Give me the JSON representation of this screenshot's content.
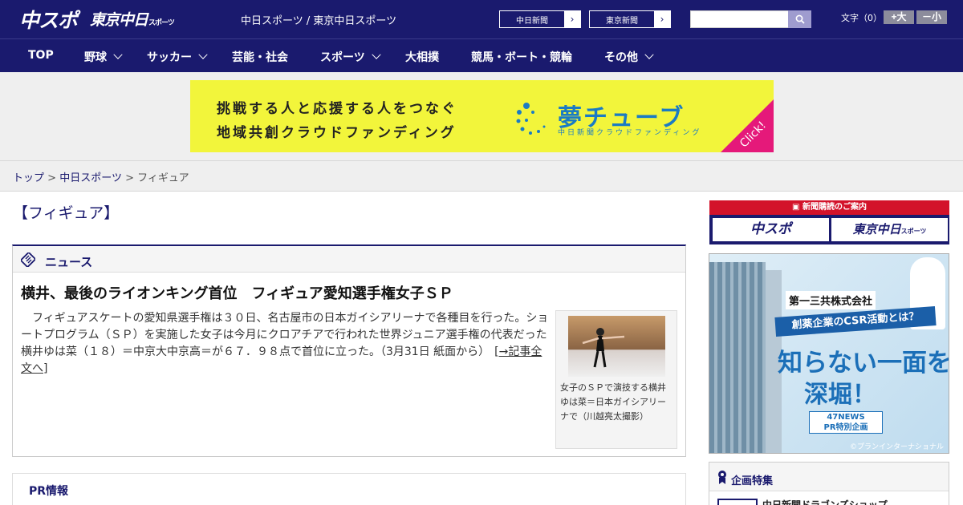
{
  "header": {
    "logo_main": "中スポ",
    "logo_tokyo": "東京中日",
    "logo_tokyo_small": "スポーツ",
    "site_title": "中日スポーツ / 東京中日スポーツ",
    "link_chunichi": "中日新聞",
    "link_tokyo": "東京新聞",
    "link_arrow": "›",
    "search_placeholder": "",
    "font_size_label": "文字（0）",
    "font_plus": "+大",
    "font_minus": "－小"
  },
  "nav": {
    "items": [
      {
        "label": "TOP",
        "has_dropdown": false
      },
      {
        "label": "野球",
        "has_dropdown": true
      },
      {
        "label": "サッカー",
        "has_dropdown": true
      },
      {
        "label": "芸能・社会",
        "has_dropdown": false
      },
      {
        "label": "スポーツ",
        "has_dropdown": true
      },
      {
        "label": "大相撲",
        "has_dropdown": false
      },
      {
        "label": "競馬・ボート・競輪",
        "has_dropdown": false
      },
      {
        "label": "その他",
        "has_dropdown": true
      }
    ]
  },
  "banner": {
    "line1": "挑戦する人と応援する人をつなぐ",
    "line2": "地域共創クラウドファンディング",
    "brand": "夢チューブ",
    "sub": "中日新聞クラウドファンディング",
    "click": "Click!"
  },
  "breadcrumb": {
    "top": "トップ",
    "sep1": ">",
    "section": "中日スポーツ",
    "sep2": ">",
    "current": "フィギュア"
  },
  "page": {
    "title": "【フィギュア】"
  },
  "news": {
    "section_label": "ニュース",
    "headline": "横井、最後のライオンキング首位　フィギュア愛知選手権女子ＳＰ",
    "body": "　フィギュアスケートの愛知県選手権は３０日、名古屋市の日本ガイシアリーナで各種目を行った。ショートプログラム（ＳＰ）を実施した女子は今月にクロアチアで行われた世界ジュニア選手権の代表だった横井ゆは菜（１８）＝中京大中京高＝が６７．９８点で首位に立った。（3月31日 紙面から）",
    "more_link": "[→記事全文へ]",
    "photo_caption": "女子のＳＰで演技する横井ゆは菜＝日本ガイシアリーナで（川越亮太撮影）"
  },
  "pr": {
    "label": "PR情報"
  },
  "sidebar": {
    "subscription_head": "新聞購読のご案内",
    "sub_chuspo": "中スポ",
    "sub_tokyo": "東京中日",
    "sub_tokyo_small": "スポーツ",
    "ad_company": "第一三共株式会社",
    "ad_ribbon": "創薬企業のCSR活動とは？",
    "ad_big1": "知らない一面を",
    "ad_big2": "深堀！",
    "ad_badge_line1": "47NEWS",
    "ad_badge_line2": "PR特別企画",
    "ad_credit": "©プランインターナショナル",
    "feature_label": "企画特集",
    "feature_item": "中日新聞ドラゴンズショップ"
  },
  "colors": {
    "navy": "#1a1a6e",
    "banner_yellow": "#f2f53b",
    "banner_blue": "#1a7bc4",
    "banner_pink": "#e5197a",
    "subscription_red": "#d3122a"
  }
}
